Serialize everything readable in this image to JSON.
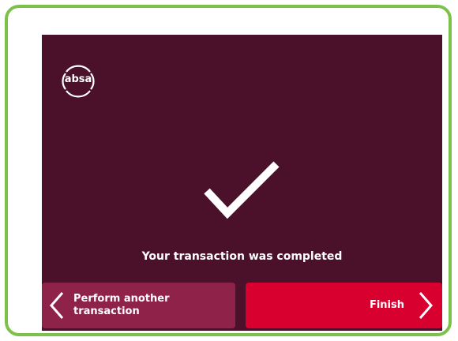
{
  "brand": {
    "logo_text": "absa"
  },
  "status": {
    "icon": "checkmark-icon",
    "message": "Your transaction was completed"
  },
  "actions": {
    "back": {
      "label": "Perform another transaction",
      "icon": "chevron-left-icon"
    },
    "finish": {
      "label": "Finish",
      "icon": "chevron-right-icon"
    }
  },
  "colors": {
    "screen_background": "#4b112a",
    "secondary_button": "#8f2248",
    "primary_button": "#d8002f",
    "frame_border": "#7cc24a"
  }
}
